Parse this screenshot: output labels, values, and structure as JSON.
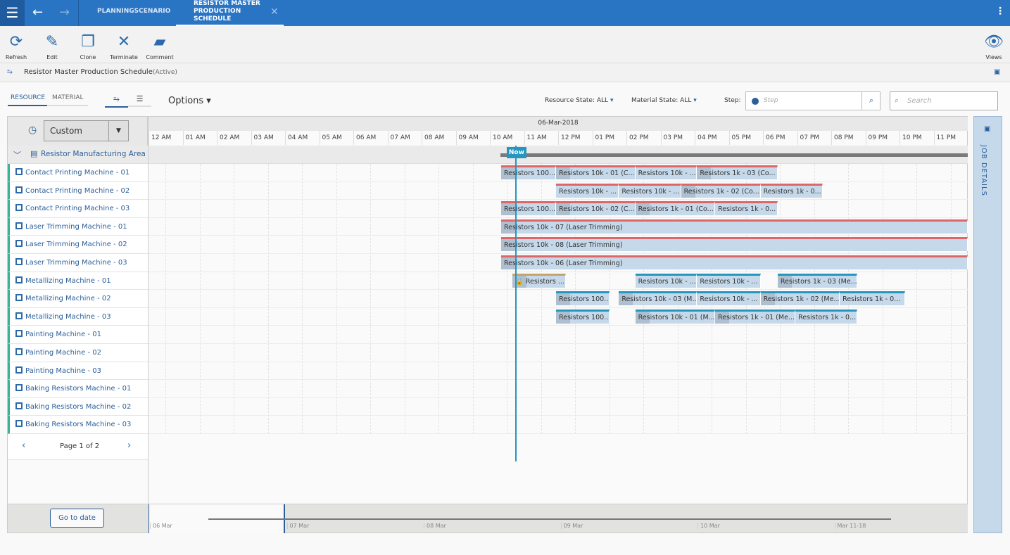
{
  "nav": {
    "tabs": [
      {
        "label": "PLANNINGSCENARIO"
      },
      {
        "label": "RESISTOR MASTER PRODUCTION SCHEDULE"
      }
    ]
  },
  "toolbar": {
    "refresh": "Refresh",
    "edit": "Edit",
    "clone": "Clone",
    "terminate": "Terminate",
    "comment": "Comment",
    "views": "Views"
  },
  "title": {
    "name": "Resistor Master Production Schedule",
    "status": "(Active)"
  },
  "controls": {
    "tab_resource": "RESOURCE",
    "tab_material": "MATERIAL",
    "options": "Options",
    "resource_state_label": "Resource State:",
    "resource_state": "ALL",
    "material_state_label": "Material State:",
    "material_state": "ALL",
    "step_label": "Step:",
    "step_placeholder": "Step",
    "search_placeholder": "Search"
  },
  "timeline": {
    "date": "06-Mar-2018",
    "view": "Custom",
    "now": "Now",
    "now_hour": 10.74,
    "hours": [
      "12 AM",
      "01 AM",
      "02 AM",
      "03 AM",
      "04 AM",
      "05 AM",
      "06 AM",
      "07 AM",
      "08 AM",
      "09 AM",
      "10 AM",
      "11 AM",
      "12 PM",
      "01 PM",
      "02 PM",
      "03 PM",
      "04 PM",
      "05 PM",
      "06 PM",
      "07 PM",
      "08 PM",
      "09 PM",
      "10 PM",
      "11 PM"
    ]
  },
  "area": "Resistor Manufacturing Area",
  "resources": [
    "Contact Printing Machine - 01",
    "Contact Printing Machine - 02",
    "Contact Printing Machine - 03",
    "Laser Trimming Machine - 01",
    "Laser Trimming Machine - 02",
    "Laser Trimming Machine - 03",
    "Metallizing Machine - 01",
    "Metallizing Machine - 02",
    "Metallizing Machine - 03",
    "Painting Machine - 01",
    "Painting Machine - 02",
    "Painting Machine - 03",
    "Baking Resistors Machine - 01",
    "Baking Resistors Machine - 02",
    "Baking Resistors Machine - 03"
  ],
  "jobs": [
    {
      "row": 0,
      "start": 10.33,
      "end": 11.94,
      "label": "Resistors 100...",
      "color": "#d66"
    },
    {
      "row": 0,
      "start": 11.94,
      "end": 14.26,
      "label": "Resistors 10k - 01 (C...",
      "color": "#d66",
      "nosetup": false
    },
    {
      "row": 0,
      "start": 14.26,
      "end": 16.07,
      "label": "Resistors 10k - ...",
      "color": "#d66",
      "nosetup": true
    },
    {
      "row": 0,
      "start": 16.07,
      "end": 18.43,
      "label": "Resistors 1k - 03 (Co...",
      "color": "#d66"
    },
    {
      "row": 1,
      "start": 11.94,
      "end": 13.78,
      "label": "Resistors 10k - ...",
      "color": "#d66",
      "nosetup": true
    },
    {
      "row": 1,
      "start": 13.78,
      "end": 15.6,
      "label": "Resistors 10k - ...",
      "color": "#d66",
      "nosetup": true
    },
    {
      "row": 1,
      "start": 15.6,
      "end": 17.93,
      "label": "Resistors 1k - 02 (Co...",
      "color": "#d66"
    },
    {
      "row": 1,
      "start": 17.93,
      "end": 19.75,
      "label": "Resistors 1k - 0...",
      "color": "#d66",
      "nosetup": true
    },
    {
      "row": 2,
      "start": 10.33,
      "end": 11.94,
      "label": "Resistors 100...",
      "color": "#d66"
    },
    {
      "row": 2,
      "start": 11.94,
      "end": 14.26,
      "label": "Resistors 10k - 02 (C...",
      "color": "#d66"
    },
    {
      "row": 2,
      "start": 14.26,
      "end": 16.6,
      "label": "Resistors 1k - 01 (Co...",
      "color": "#d66"
    },
    {
      "row": 2,
      "start": 16.6,
      "end": 18.43,
      "label": "Resistors 1k - 0...",
      "color": "#d66",
      "nosetup": true
    },
    {
      "row": 3,
      "start": 10.33,
      "end": 24,
      "label": "Resistors 10k - 07 (Laser Trimming)",
      "color": "#d66"
    },
    {
      "row": 4,
      "start": 10.33,
      "end": 24,
      "label": "Resistors 10k - 08 (Laser Trimming)",
      "color": "#d66"
    },
    {
      "row": 5,
      "start": 10.33,
      "end": 24,
      "label": "Resistors 10k - 06 (Laser Trimming)",
      "color": "#d66"
    },
    {
      "row": 6,
      "start": 10.66,
      "end": 12.23,
      "label": "🔒 Resistors ...",
      "color": "#c4a46a"
    },
    {
      "row": 6,
      "start": 14.26,
      "end": 16.07,
      "label": "Resistors 10k - ...",
      "color": "#2596be",
      "nosetup": true
    },
    {
      "row": 6,
      "start": 16.07,
      "end": 17.93,
      "label": "Resistors 10k - ...",
      "color": "#2596be",
      "nosetup": true
    },
    {
      "row": 6,
      "start": 18.43,
      "end": 20.76,
      "label": "Resistors 1k - 03 (Me...",
      "color": "#2596be"
    },
    {
      "row": 7,
      "start": 11.94,
      "end": 13.51,
      "label": "Resistors 100...",
      "color": "#2596be"
    },
    {
      "row": 7,
      "start": 13.78,
      "end": 16.07,
      "label": "Resistors 10k - 03 (M...",
      "color": "#2596be"
    },
    {
      "row": 7,
      "start": 16.07,
      "end": 17.93,
      "label": "Resistors 10k - ...",
      "color": "#2596be",
      "nosetup": true
    },
    {
      "row": 7,
      "start": 17.93,
      "end": 20.25,
      "label": "Resistors 1k - 02 (Me...",
      "color": "#2596be"
    },
    {
      "row": 7,
      "start": 20.25,
      "end": 22.16,
      "label": "Resistors 1k - 0...",
      "color": "#2596be",
      "nosetup": true
    },
    {
      "row": 8,
      "start": 11.94,
      "end": 13.51,
      "label": "Resistors 100...",
      "color": "#2596be"
    },
    {
      "row": 8,
      "start": 14.26,
      "end": 16.6,
      "label": "Resistors 10k - 01 (M...",
      "color": "#2596be"
    },
    {
      "row": 8,
      "start": 16.6,
      "end": 18.95,
      "label": "Resistors 1k - 01 (Me...",
      "color": "#2596be"
    },
    {
      "row": 8,
      "start": 18.95,
      "end": 20.76,
      "label": "Resistors 1k - 0...",
      "color": "#2596be",
      "nosetup": true
    }
  ],
  "pager": {
    "label": "Page 1 of 2"
  },
  "goto": "Go to date",
  "overview": [
    "06 Mar",
    "07 Mar",
    "08 Mar",
    "09 Mar",
    "10 Mar",
    "Mar 11-18"
  ],
  "job_details": "JOB DETAILS"
}
